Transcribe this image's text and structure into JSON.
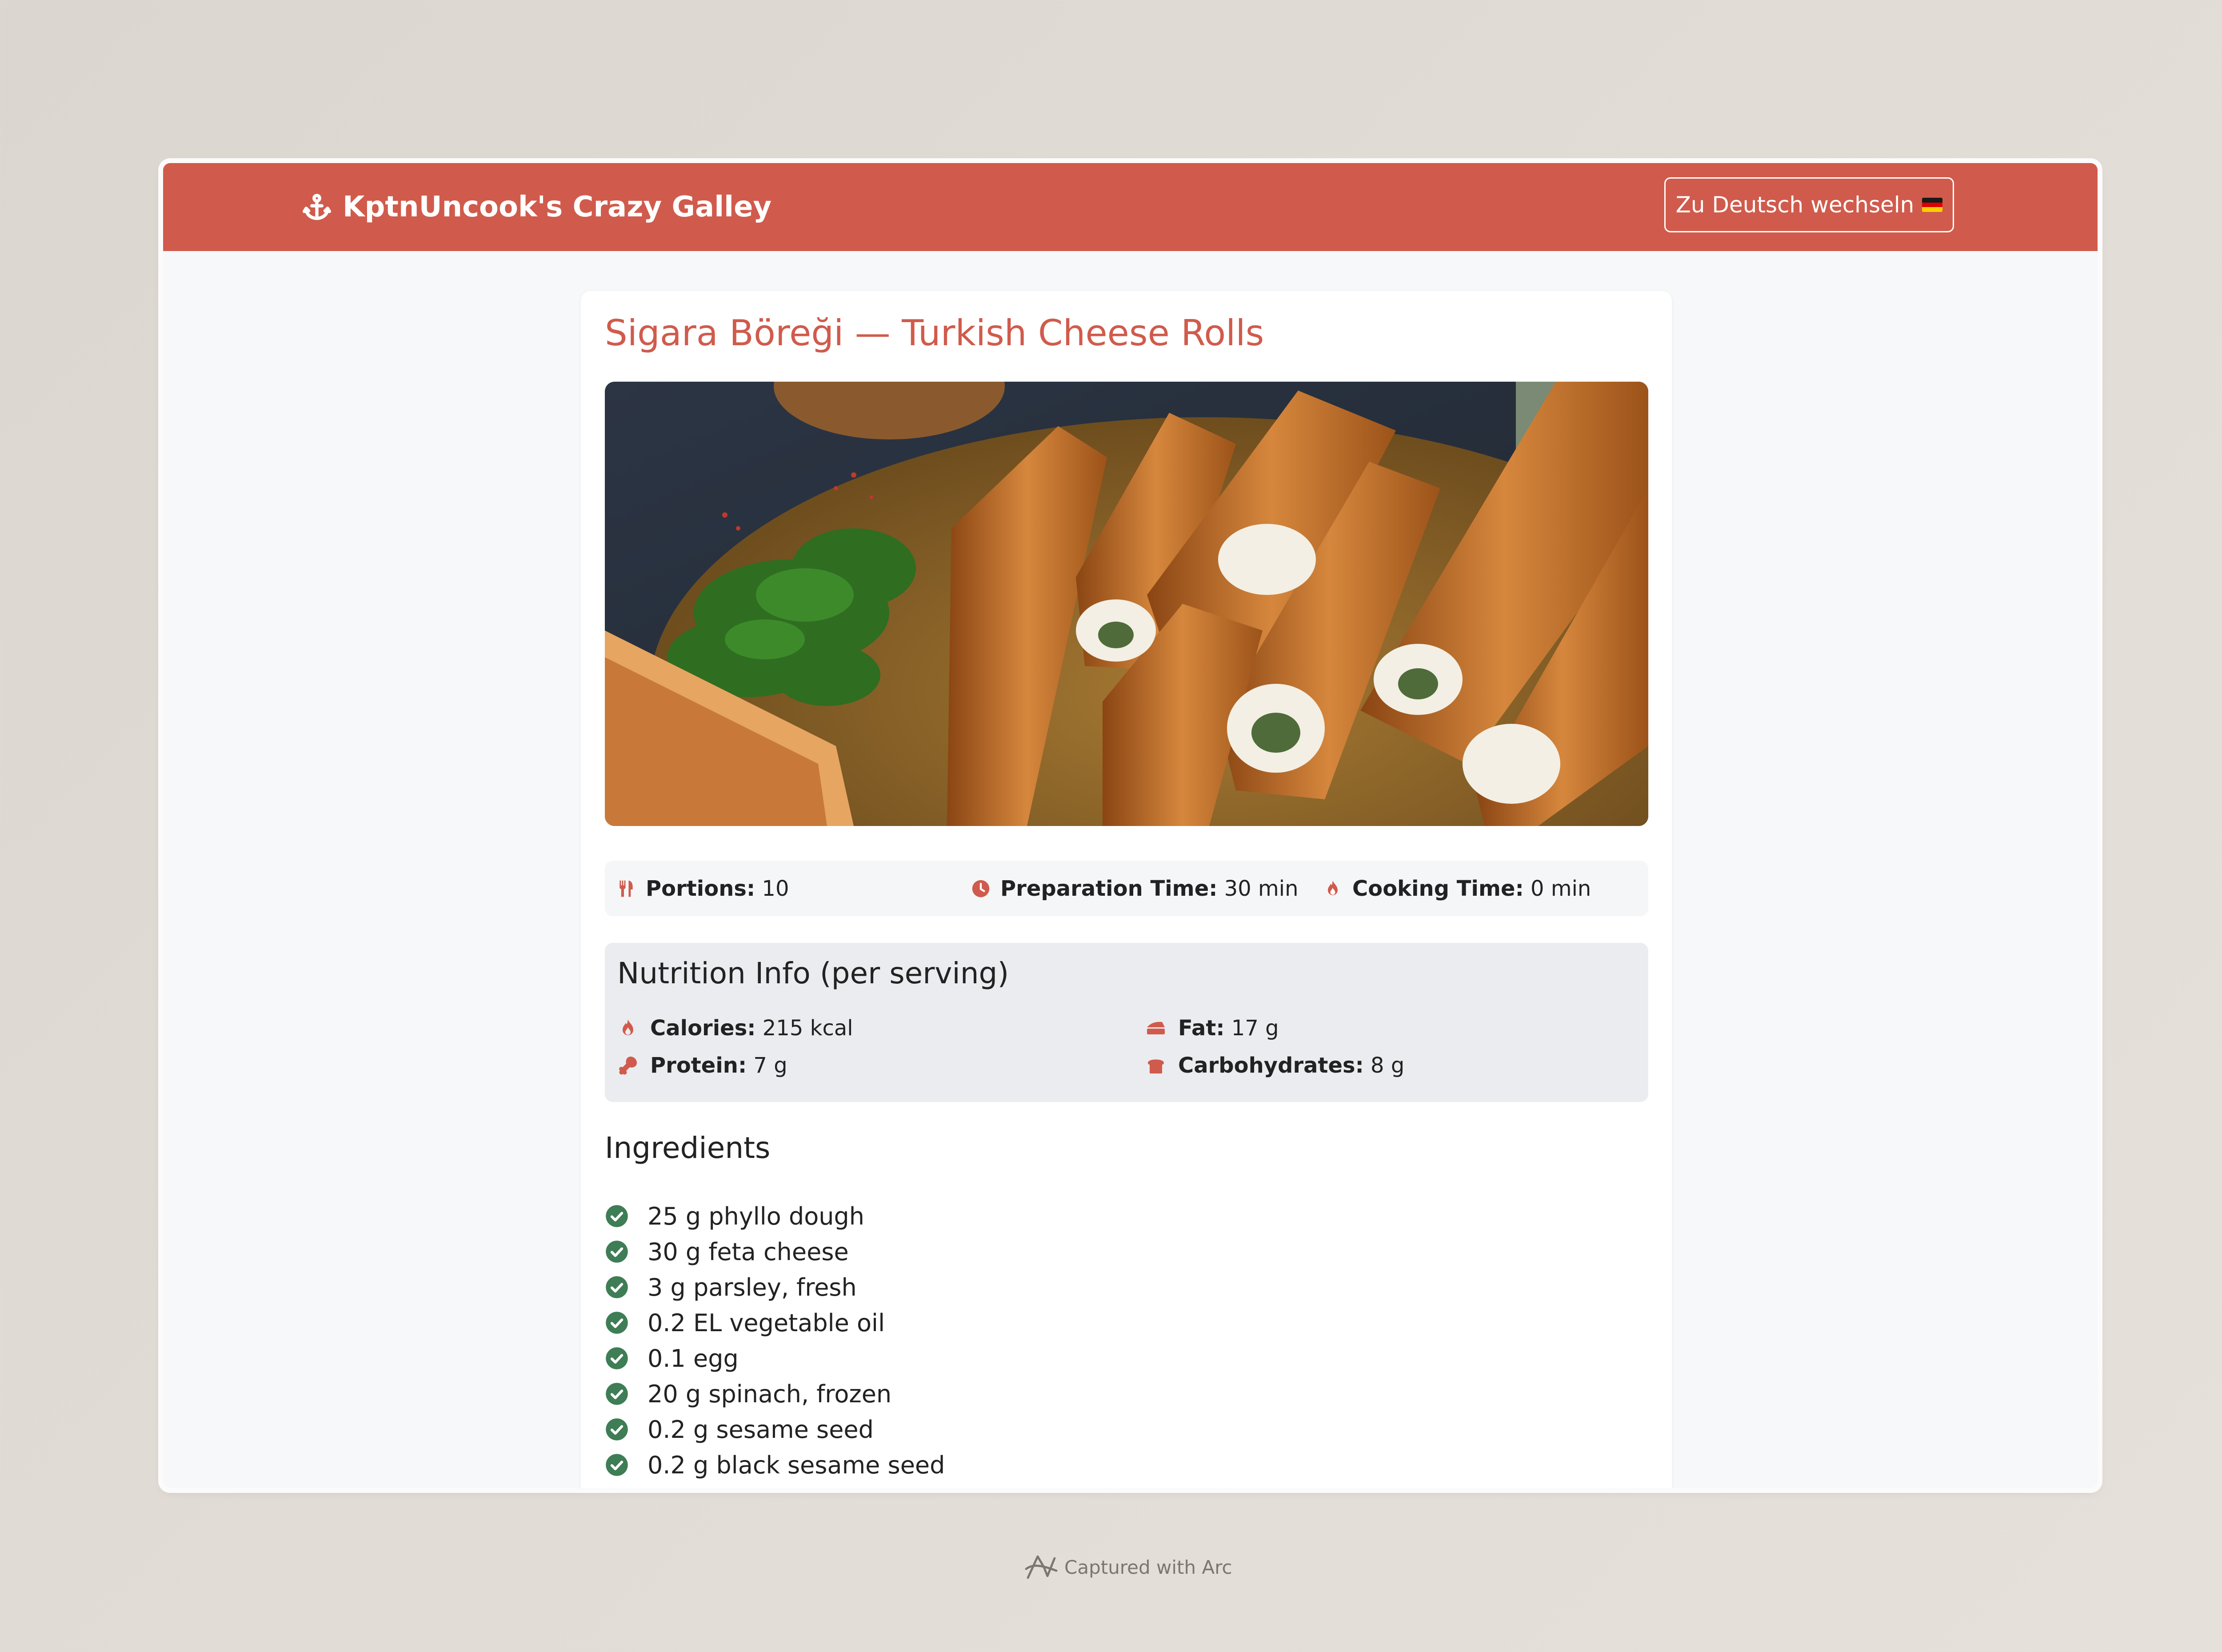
{
  "header": {
    "brand": "KptnUncook's Crazy Galley",
    "language_button": "Zu Deutsch wechseln"
  },
  "recipe": {
    "title": "Sigara Böreği — Turkish Cheese Rolls",
    "meta": {
      "portions_label": "Portions:",
      "portions_value": "10",
      "prep_label": "Preparation Time:",
      "prep_value": "30 min",
      "cook_label": "Cooking Time:",
      "cook_value": "0 min"
    },
    "nutrition": {
      "title": "Nutrition Info (per serving)",
      "calories_label": "Calories:",
      "calories_value": "215 kcal",
      "fat_label": "Fat:",
      "fat_value": "17 g",
      "protein_label": "Protein:",
      "protein_value": "7 g",
      "carbs_label": "Carbohydrates:",
      "carbs_value": "8 g"
    },
    "ingredients_title": "Ingredients",
    "ingredients": [
      "25 g phyllo dough",
      "30 g feta cheese",
      "3 g parsley, fresh",
      "0.2 EL vegetable oil",
      "0.1 egg",
      "20 g spinach, frozen",
      "0.2 g sesame seed",
      "0.2 g black sesame seed"
    ]
  },
  "footer": {
    "captured": "Captured with Arc"
  },
  "colors": {
    "brand": "#d05b4c",
    "check": "#3e7d55",
    "background": "#f7f8fa"
  }
}
